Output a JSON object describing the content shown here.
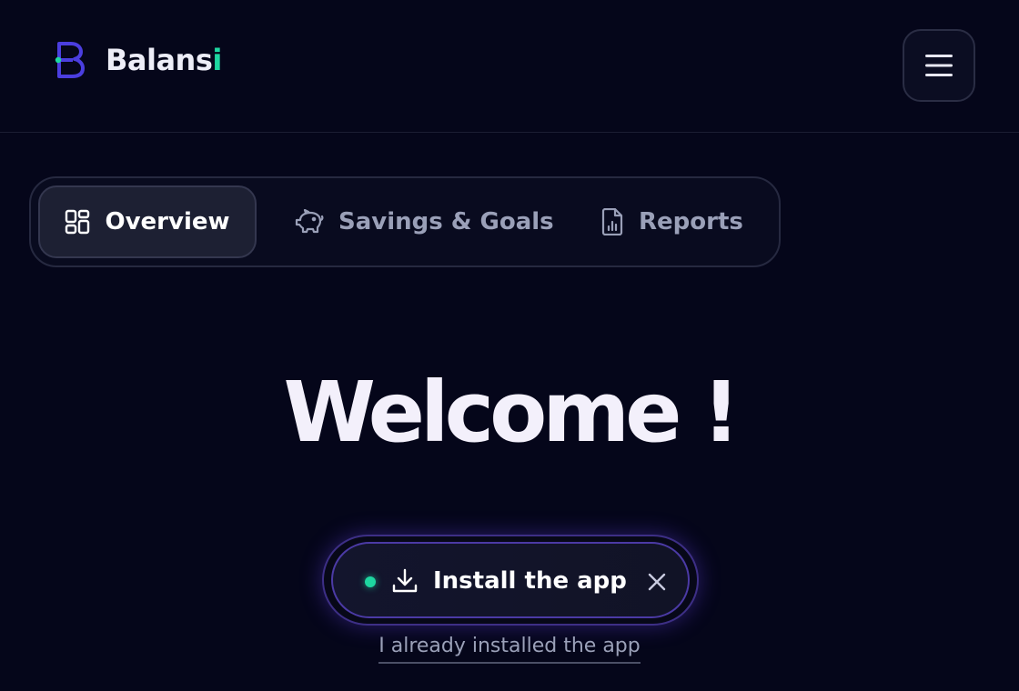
{
  "header": {
    "brand_main": "Balans",
    "brand_accent": "i",
    "menu_icon": "hamburger-menu-icon"
  },
  "tabs": [
    {
      "label": "Overview",
      "icon": "grid-icon",
      "active": true
    },
    {
      "label": "Savings & Goals",
      "icon": "piggy-bank-icon",
      "active": false
    },
    {
      "label": "Reports",
      "icon": "report-file-icon",
      "active": false
    }
  ],
  "main": {
    "welcome": "Welcome !",
    "install_label": "Install the app",
    "install_icon": "download-icon",
    "close_icon": "close-icon",
    "already_installed": "I already installed the app"
  },
  "colors": {
    "background": "#05061a",
    "accent_green": "#1ed6a0",
    "accent_purple": "#4b3aa5",
    "text_muted": "#9aa0b8"
  }
}
